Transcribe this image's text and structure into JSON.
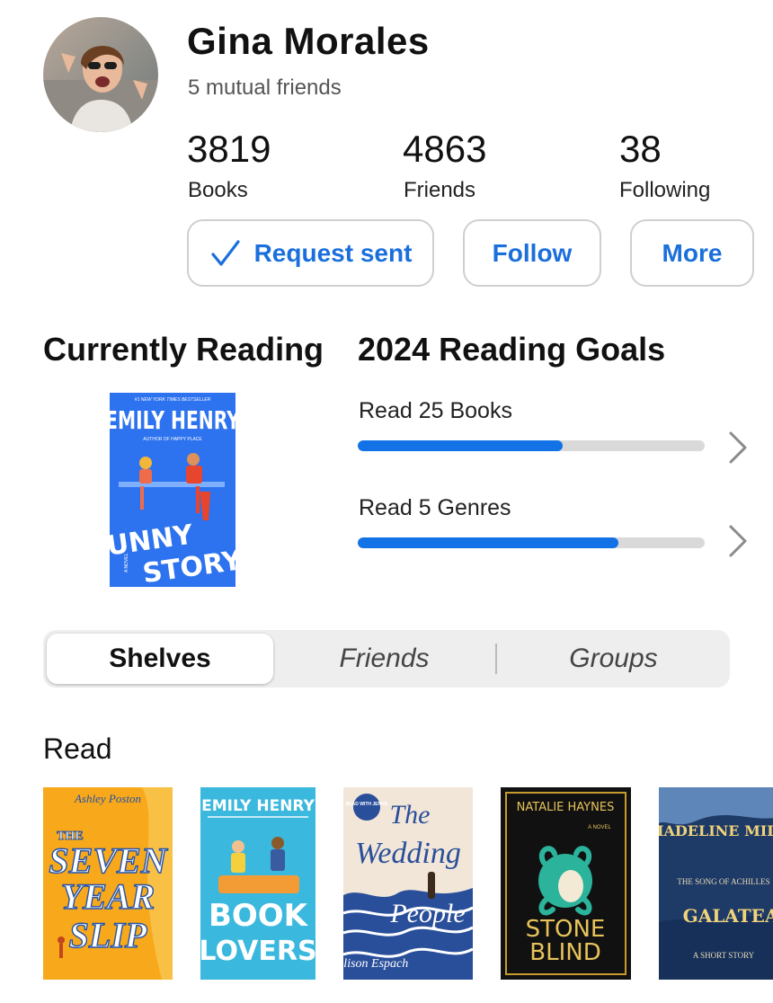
{
  "profile": {
    "name": "Gina Morales",
    "mutual": "5 mutual friends",
    "stats": [
      {
        "value": "3819",
        "label": "Books"
      },
      {
        "value": "4863",
        "label": "Friends"
      },
      {
        "value": "38",
        "label": "Following"
      }
    ],
    "buttons": {
      "request": "Request sent",
      "follow": "Follow",
      "more": "More"
    }
  },
  "currently_reading": {
    "title": "Currently Reading",
    "book": {
      "author": "EMILY HENRY",
      "tagline": "#1 NEW YORK TIMES BESTSELLER",
      "subtitle": "AUTHOR OF HAPPY PLACE",
      "title_line1": "FUNNY",
      "title_line2": "STORY",
      "side": "A NOVEL"
    }
  },
  "goals": {
    "title": "2024 Reading Goals",
    "items": [
      {
        "label": "Read 25 Books",
        "progress": 0.59
      },
      {
        "label": "Read 5 Genres",
        "progress": 0.75
      }
    ]
  },
  "tabs": {
    "items": [
      "Shelves",
      "Friends",
      "Groups"
    ],
    "active": "Shelves"
  },
  "shelf": {
    "title": "Read",
    "books": [
      {
        "author": "Ashley Poston",
        "l1": "THE",
        "l2": "SEVEN",
        "l3": "YEAR",
        "l4": "SLIP",
        "bg": "#f7a81b"
      },
      {
        "author": "EMILY HENRY",
        "l1": "BOOK",
        "l2": "LOVERS",
        "bg": "#3ab8dd"
      },
      {
        "author": "Alison Espach",
        "l1": "The",
        "l2": "Wedding",
        "l3": "People",
        "badge": "READ WITH JENNA",
        "bg": "#f2e6d8"
      },
      {
        "author": "NATALIE HAYNES",
        "l1": "STONE",
        "l2": "BLIND",
        "side": "A NOVEL",
        "bg": "#111111"
      },
      {
        "author": "MADELINE MILLER",
        "l1": "GALATEA",
        "l2": "THE SONG OF ACHILLES",
        "side": "A SHORT STORY",
        "bg": "#1e3a66"
      }
    ]
  },
  "colors": {
    "accent": "#1a6fdc",
    "progress": "#1272e6",
    "track": "#d9d9d9"
  }
}
